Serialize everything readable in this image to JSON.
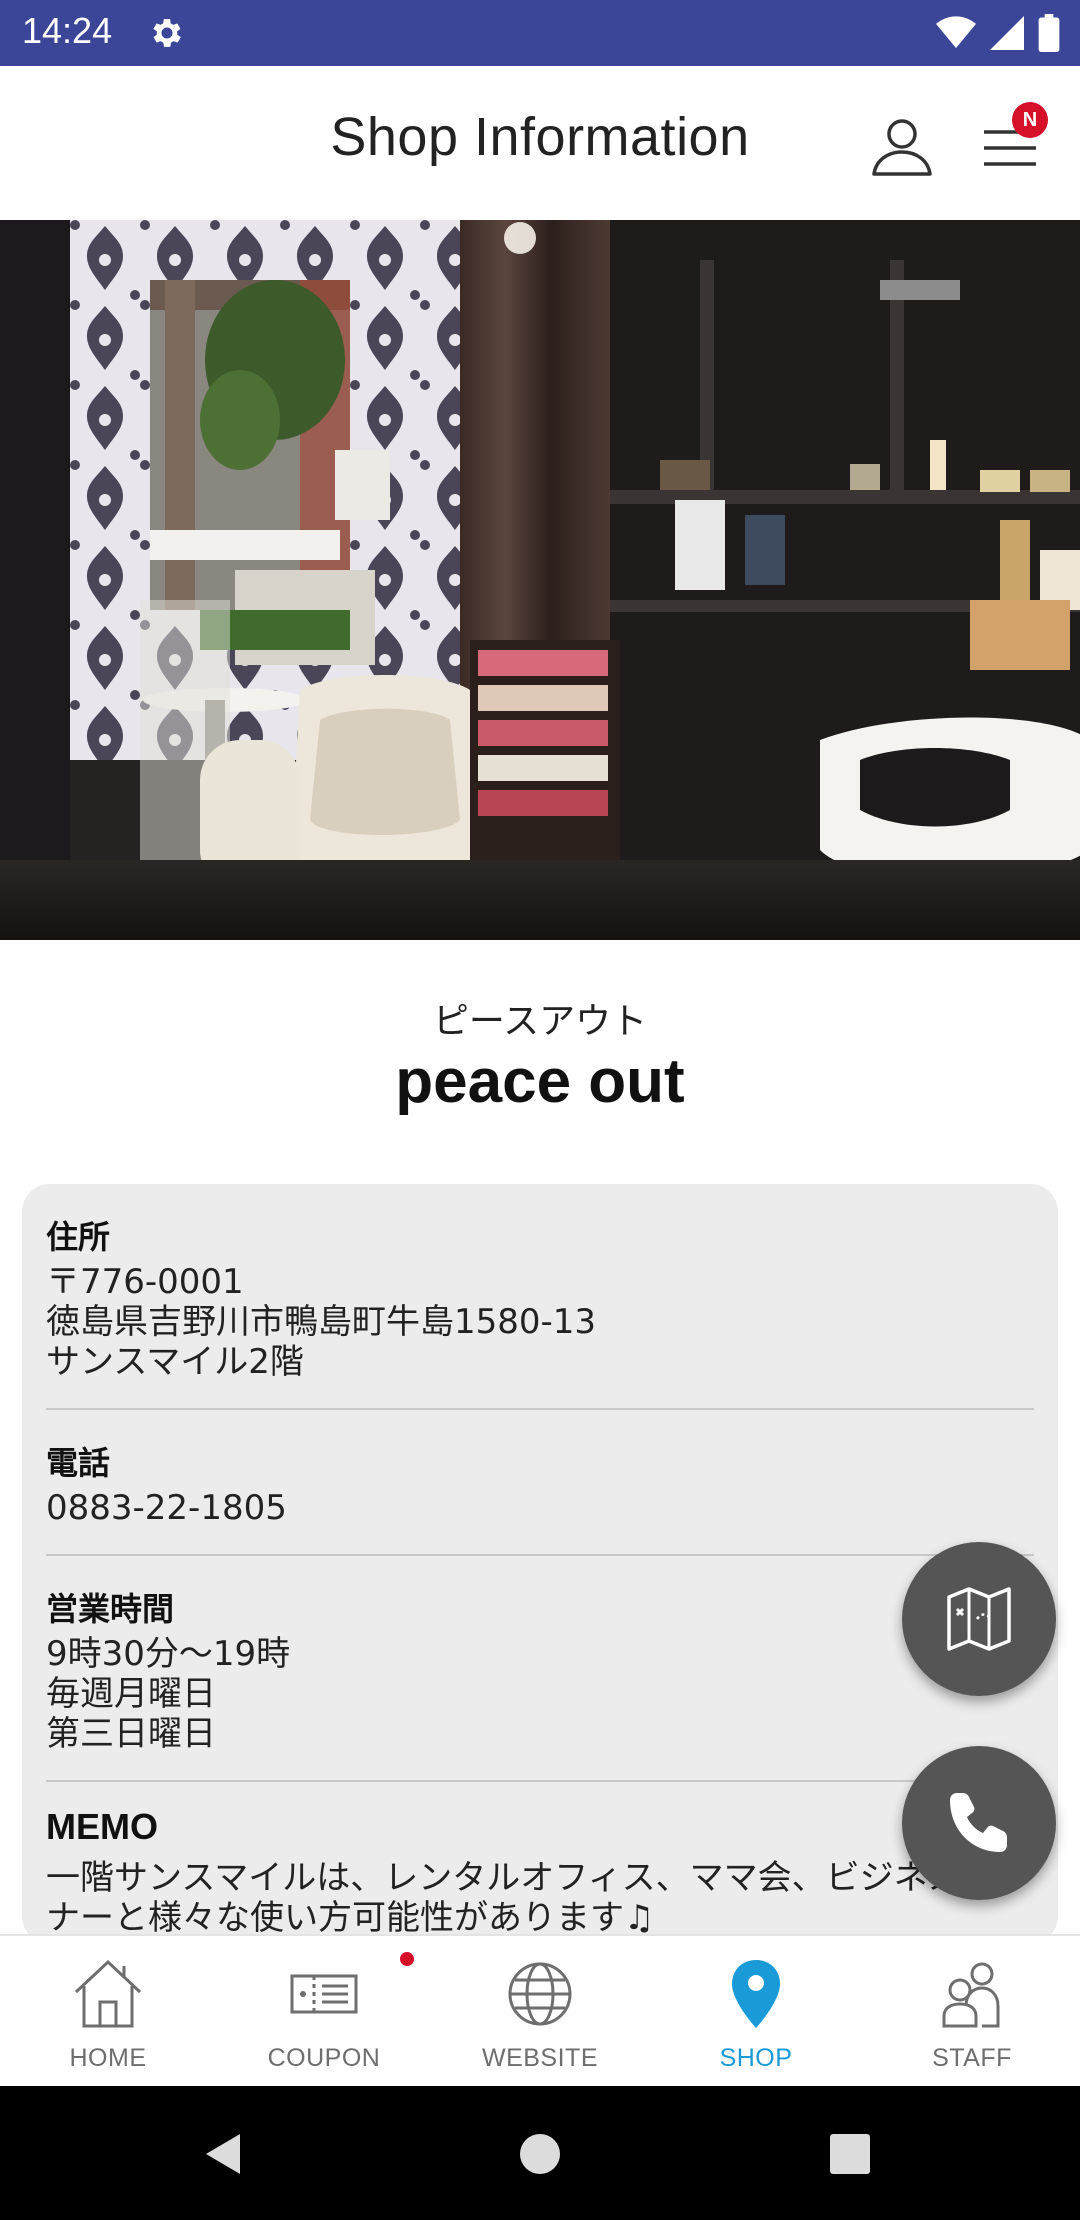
{
  "status_bar": {
    "time": "14:24",
    "color": "#3c4698"
  },
  "header": {
    "title": "Shop Information",
    "menu_badge": "N"
  },
  "shop": {
    "kana": "ピースアウト",
    "name": "peace out"
  },
  "info": {
    "address_label": "住所",
    "address_value": "〒776-0001\n徳島県吉野川市鴨島町牛島1580-13\nサンスマイル2階",
    "phone_label": "電話",
    "phone_value": "0883-22-1805",
    "hours_label": "営業時間",
    "hours_value": "9時30分〜19時\n毎週月曜日\n第三日曜日",
    "memo_label": "MEMO",
    "memo_value": "一階サンスマイルは、レンタルオフィス、ママ会、ビジネス\nナーと様々な使い方可能性があります♫"
  },
  "bottom_nav": {
    "items": [
      {
        "label": "HOME",
        "icon": "home-icon"
      },
      {
        "label": "COUPON",
        "icon": "coupon-icon"
      },
      {
        "label": "WEBSITE",
        "icon": "globe-icon"
      },
      {
        "label": "SHOP",
        "icon": "map-pin-icon"
      },
      {
        "label": "STAFF",
        "icon": "staff-icon"
      }
    ],
    "active_index": 3,
    "active_color": "#1a9ad6",
    "inactive_color": "#6e6e6e"
  },
  "colors": {
    "badge_red": "#d7102a",
    "card_bg": "#ececec",
    "fab_bg": "#555555"
  }
}
